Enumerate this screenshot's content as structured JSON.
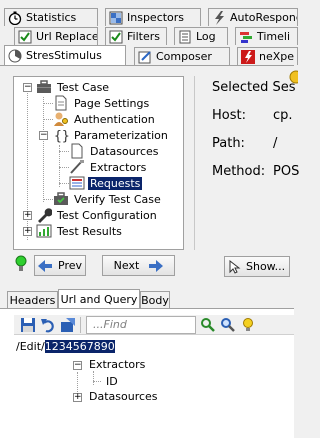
{
  "top_tabs_row1": [
    {
      "label": "Statistics",
      "icon": "stopwatch-icon"
    },
    {
      "label": "Inspectors",
      "icon": "inspector-icon"
    },
    {
      "label": "AutoRespond",
      "icon": "lightning-icon"
    }
  ],
  "top_tabs_row2": [
    {
      "label": "Url Replace",
      "icon": "checkbox-icon"
    },
    {
      "label": "Filters",
      "icon": "checkbox-icon"
    },
    {
      "label": "Log",
      "icon": "log-icon"
    },
    {
      "label": "Timeli",
      "icon": "timeline-icon"
    }
  ],
  "top_tabs_row3": [
    {
      "label": "StresStimulus",
      "icon": "stresstimulus-icon"
    },
    {
      "label": "Composer",
      "icon": "composer-icon"
    },
    {
      "label": "neXpe",
      "icon": "nexpert-icon"
    }
  ],
  "tree": {
    "items": [
      {
        "label": "Test Case",
        "icon": "briefcase-icon"
      },
      {
        "label": "Page Settings",
        "icon": "page-icon"
      },
      {
        "label": "Authentication",
        "icon": "user-key-icon"
      },
      {
        "label": "Parameterization",
        "icon": "braces-icon"
      },
      {
        "label": "Datasources",
        "icon": "page-icon"
      },
      {
        "label": "Extractors",
        "icon": "extractor-icon"
      },
      {
        "label": "Requests",
        "icon": "requests-icon"
      },
      {
        "label": "Verify Test Case",
        "icon": "briefcase-check-icon"
      },
      {
        "label": "Test Configuration",
        "icon": "wrench-icon"
      },
      {
        "label": "Test Results",
        "icon": "results-icon"
      }
    ],
    "prev_label": "Prev",
    "next_label": "Next"
  },
  "details": {
    "title": "Selected Ses",
    "host_label": "Host:",
    "host_value": "cp.",
    "path_label": "Path:",
    "path_value": "/",
    "method_label": "Method:",
    "method_value": "POS",
    "show_label": "Show..."
  },
  "sub_tabs": [
    "Headers",
    "Url and Query",
    "Body"
  ],
  "toolbar": {
    "find_placeholder": "...Find"
  },
  "url": {
    "prefix": "/Edit/",
    "selected": "1234567890"
  },
  "url_tree": [
    {
      "label": "Extractors"
    },
    {
      "label": "ID"
    },
    {
      "label": "Datasources"
    }
  ]
}
